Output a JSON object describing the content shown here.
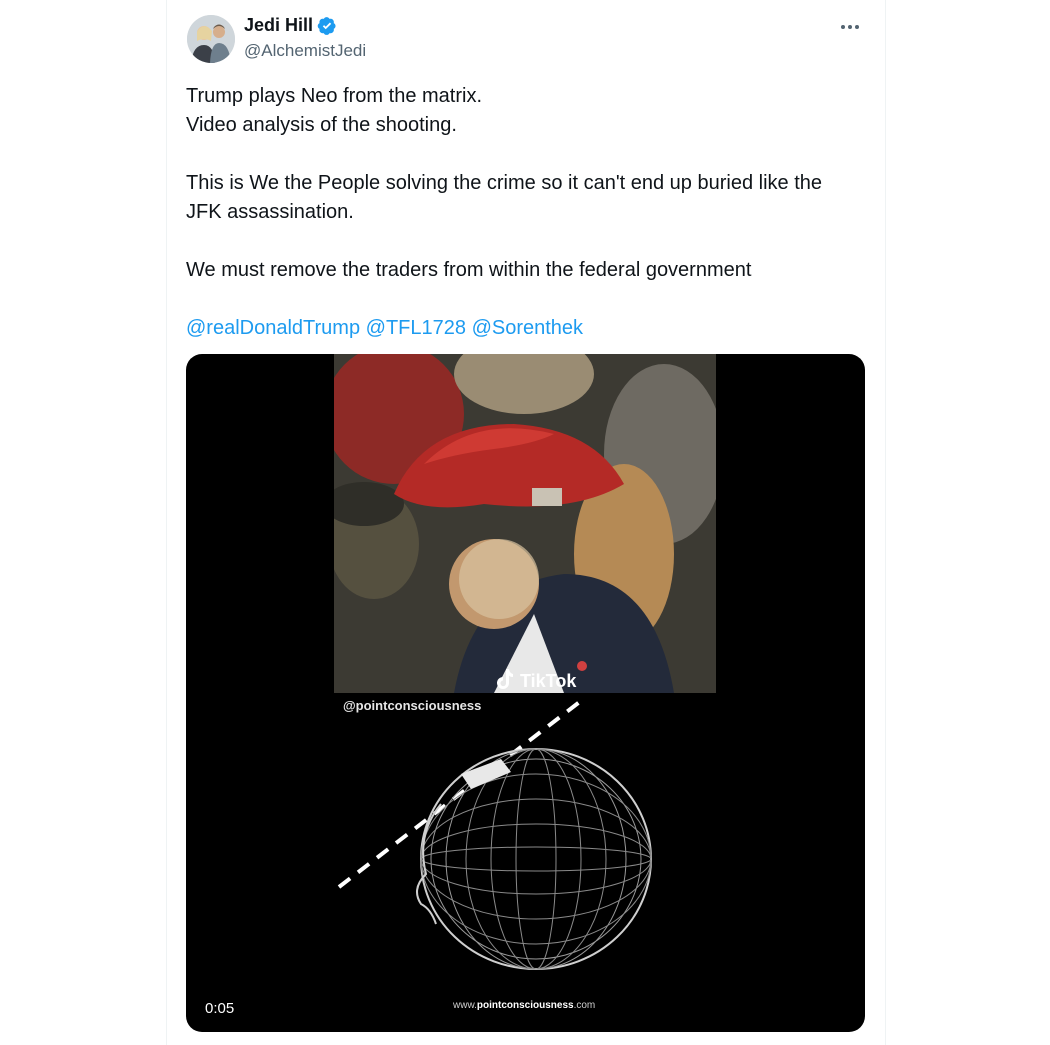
{
  "author": {
    "name": "Jedi Hill",
    "handle": "@AlchemistJedi",
    "verified": true
  },
  "tweet": {
    "line1": "Trump plays Neo from the matrix.",
    "line2": "Video analysis of the shooting.",
    "line3": "This is We the People solving the crime so it can't end up buried like the",
    "line4": "JFK assassination.",
    "line5": "We must remove the traders from within the federal government",
    "mentions": [
      "@realDonaldTrump",
      "@TFL1728",
      "@Sorenthek"
    ]
  },
  "video": {
    "tiktok_label": "TikTok",
    "tiktok_user": "@pointconsciousness",
    "site_prefix": "www.",
    "site_brand": "pointconsciousness",
    "site_suffix": ".com",
    "timestamp": "0:05"
  },
  "icons": {
    "more": "more-horizontal-icon",
    "verified": "verified-badge-icon",
    "tiktok": "tiktok-logo-icon"
  },
  "colors": {
    "link": "#1d9bf0",
    "text": "#0f1419",
    "secondary": "#536471",
    "media_bg": "#000000"
  }
}
